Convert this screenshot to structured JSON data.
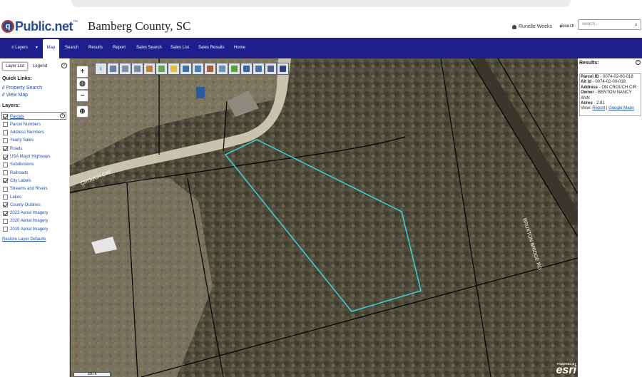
{
  "site": {
    "logo_text_prefix": "q",
    "logo_text": "Public.net",
    "logo_tm": "™",
    "county_title": "Bamberg County, SC"
  },
  "header": {
    "user_name": "Runelle Weeks",
    "search_link": "Search",
    "search_placeholder": "search..."
  },
  "nav": {
    "layers": "Layers",
    "items": [
      "Map",
      "Search",
      "Results",
      "Report",
      "Sales Search",
      "Sales List",
      "Sales Results",
      "Home"
    ]
  },
  "sidebar": {
    "tabs": [
      "Layer List",
      "Legend"
    ],
    "quick_links_heading": "Quick Links:",
    "quick_links": [
      "Property Search",
      "View Map"
    ],
    "layers_heading": "Layers:",
    "layers": [
      {
        "label": "Parcels",
        "checked": true
      },
      {
        "label": "Parcel Numbers",
        "checked": false
      },
      {
        "label": "Address Numbers",
        "checked": false
      },
      {
        "label": "Yearly Sales",
        "checked": false
      },
      {
        "label": "Roads",
        "checked": true
      },
      {
        "label": "USA Major Highways",
        "checked": true
      },
      {
        "label": "Subdivisions",
        "checked": false
      },
      {
        "label": "Railroads",
        "checked": false
      },
      {
        "label": "City Labels",
        "checked": true
      },
      {
        "label": "Streams and Rivers",
        "checked": false
      },
      {
        "label": "Lakes",
        "checked": false
      },
      {
        "label": "County Outlines",
        "checked": true
      },
      {
        "label": "2023 Aerial Imagery",
        "checked": true
      },
      {
        "label": "2020 Aerial Imagery",
        "checked": false
      },
      {
        "label": "2019 Aerial Imagery",
        "checked": false
      }
    ],
    "restore_link": "Restore Layer Defaults"
  },
  "map": {
    "road_label_1": "CROUCH CIR",
    "road_label_2": "BRUXTON BRIDGE RD",
    "scale_label": "100 ft",
    "powered_by": "POWERED BY",
    "esri": "esri"
  },
  "results": {
    "title": "Results:",
    "parcel_id_label": "Parcel ID",
    "parcel_id": "0074-02-00-018",
    "alt_id_label": "Alt Id",
    "alt_id": "0074-02-00-018",
    "address_label": "Address",
    "address": "ON CROUCH CIR",
    "owner_label": "Owner",
    "owner": "BENTON NANCY ANN",
    "acres_label": "Acres",
    "acres": "2.81",
    "view_label": "View:",
    "report_link": "Report",
    "google_maps_link": "Google Maps"
  },
  "colors": {
    "navbar": "#1e1e8c",
    "link": "#1e4fa8",
    "parcel_highlight": "#3fd0d8"
  }
}
